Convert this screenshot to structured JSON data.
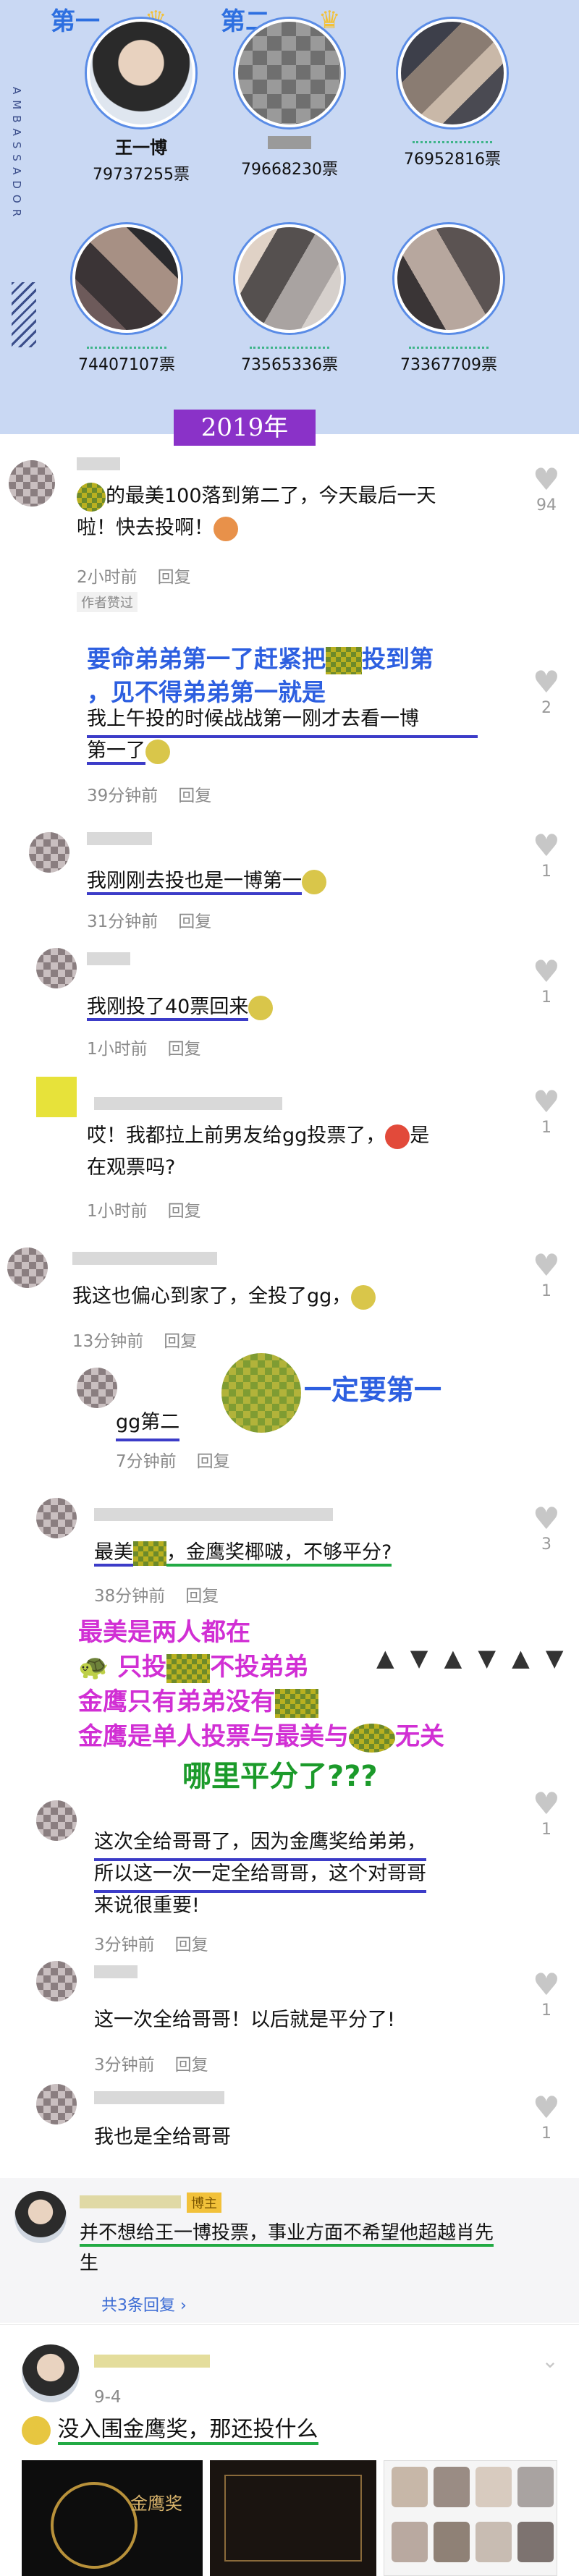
{
  "banner": {
    "side_text": "AMBASSADOR",
    "rank1": "第一",
    "rank2": "第二",
    "year": "2019年",
    "candidates": [
      {
        "name": "王一博",
        "votes": "79737255票"
      },
      {
        "name": "",
        "votes": "79668230票"
      },
      {
        "name": "",
        "votes": "76952816票"
      },
      {
        "name": "",
        "votes": "74407107票"
      },
      {
        "name": "",
        "votes": "73565336票"
      },
      {
        "name": "",
        "votes": "73367709票"
      }
    ]
  },
  "comments": [
    {
      "text1": "的最美100落到第二了，今天最后一天",
      "text2": "啦！快去投啊！",
      "time": "2小时前",
      "reply": "回复",
      "likes": "94",
      "tag": "作者赞过"
    },
    {
      "text1": "我上午投的时候战战第一刚才去看一博",
      "text2": "第一了",
      "time": "39分钟前",
      "reply": "回复",
      "likes": "2"
    },
    {
      "text1": "我刚刚去投也是一博第一",
      "time": "31分钟前",
      "reply": "回复",
      "likes": "1"
    },
    {
      "text1": "我刚投了40票回来",
      "time": "1小时前",
      "reply": "回复",
      "likes": "1"
    },
    {
      "text1": "哎！我都拉上前男友给gg投票了，",
      "text1b": "是",
      "text2": "在观票吗?",
      "time": "1小时前",
      "reply": "回复",
      "likes": "1"
    },
    {
      "text1": "我这也偏心到家了，全投了gg，",
      "time": "13分钟前",
      "reply": "回复",
      "likes": "1"
    },
    {
      "text1": "gg第二",
      "time": "7分钟前",
      "reply": "回复"
    },
    {
      "text1a": "最美",
      "text1b": "，金鹰奖椰啵，不够平分?",
      "time": "38分钟前",
      "reply": "回复",
      "likes": "3"
    },
    {
      "text1": "这次全给哥哥了，因为金鹰奖给弟弟，",
      "text2": "所以这一次一定全给哥哥，这个对哥哥",
      "text3": "来说很重要!",
      "time": "3分钟前",
      "reply": "回复",
      "likes": "1"
    },
    {
      "text1": "这一次全给哥哥！以后就是平分了!",
      "time": "3分钟前",
      "reply": "回复",
      "likes": "1"
    },
    {
      "text1": "我也是全给哥哥",
      "likes": "1"
    }
  ],
  "annotations": {
    "a1_line1": "要命弟弟第一了赶紧把",
    "a1_line1b": "投到第",
    "a1_line2": "，见不得弟弟第一就是",
    "a2": "一定要第一",
    "a3_line1": "最美是两人都在",
    "a3_line2a": "只投",
    "a3_line2b": "不投弟弟",
    "a3_line3a": "金鹰只有弟弟没有",
    "a3_line4a": "金鹰是单人投票与最美与",
    "a3_line4b": "无关",
    "a3_line5": "哪里平分了???"
  },
  "thread": {
    "badge": "博主",
    "text1": "并不想给王一博投票，事业方面不希望他超越肖先",
    "text2": "生",
    "replies": "共3条回复"
  },
  "post": {
    "date": "9-4",
    "text": "没入围金鹰奖，那还投什么",
    "panel_title": "金鹰奖"
  }
}
